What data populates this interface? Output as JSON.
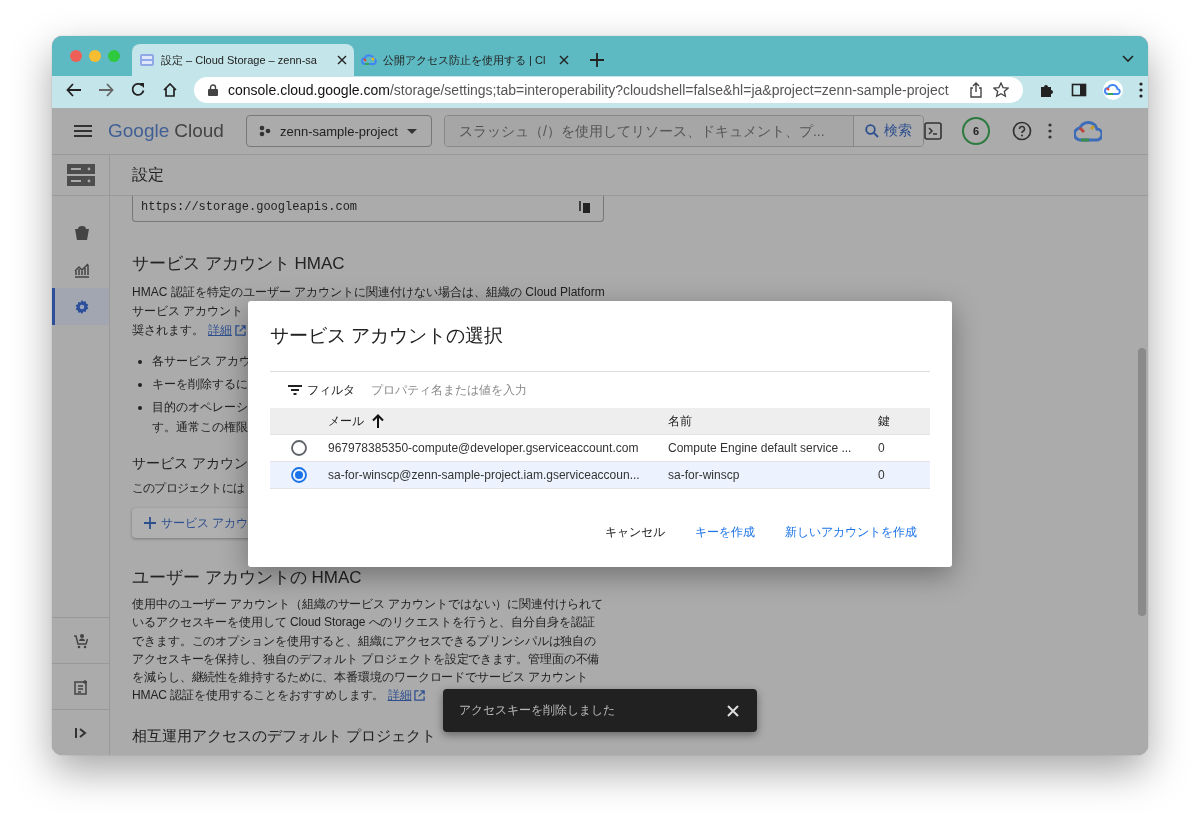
{
  "browser": {
    "tabs": [
      {
        "title": "設定 – Cloud Storage – zenn-sa",
        "selected": true
      },
      {
        "title": "公開アクセス防止を使用する | Cl",
        "selected": false
      }
    ],
    "url": {
      "host": "console.cloud.google.com",
      "path": "/storage/settings;tab=interoperability?cloudshell=false&hl=ja&project=zenn-sample-project"
    }
  },
  "header": {
    "logo": {
      "brand": "Google",
      "product": "Cloud"
    },
    "project": "zenn-sample-project",
    "search_placeholder": "スラッシュ（/）を使用してリソース、ドキュメント、プ...",
    "search_button": "検索",
    "badge": "6"
  },
  "sidebar": {
    "items": [
      {
        "kind": "bucket",
        "selected": false
      },
      {
        "kind": "chart",
        "selected": false
      },
      {
        "kind": "settings",
        "selected": true
      }
    ],
    "bottom_items": [
      {
        "kind": "cart"
      },
      {
        "kind": "notes"
      },
      {
        "kind": "expand"
      }
    ]
  },
  "page_title": "設定",
  "content": {
    "endpoint": "https://storage.googleapis.com",
    "sections": [
      {
        "heading": "サービス アカウント HMAC",
        "lines": [
          "HMAC 認証を特定のユーザー アカウントに関連付けない場合は、組織の Cloud Platform",
          "サービス アカウント"
        ],
        "last_line": "奨されます。",
        "link": "詳細",
        "bullets": [
          "各サービス アカウ",
          "キーを削除するに",
          "目的のオペレーシ"
        ],
        "bullet_tail": "す。通常この権限"
      },
      {
        "heading": "サービス アカウン",
        "lines": [
          "このプロジェクトには"
        ],
        "button": "サービス アカウ"
      },
      {
        "heading": "ユーザー アカウントの HMAC",
        "paragraph": "使用中のユーザー アカウント（組織のサービス アカウントではない）に関連付けられているアクセスキーを使用して Cloud Storage へのリクエストを行うと、自分自身を認証できます。このオプションを使用すると、組織にアクセスできるプリンシパルは独自のアクセスキーを保持し、独自のデフォルト プロジェクトを設定できます。管理面の不備を減らし、継続性を維持するために、本番環境のワークロードでサービス アカウント HMAC 認証を使用することをおすすめします。",
        "link": "詳細"
      },
      {
        "heading": "相互運用アクセスのデフォルト プロジェクト"
      }
    ]
  },
  "dialog": {
    "title": "サービス アカウントの選択",
    "filter_label": "フィルタ",
    "filter_placeholder": "プロパティ名または値を入力",
    "columns": [
      "メール",
      "名前",
      "鍵"
    ],
    "rows": [
      {
        "email": "967978385350-compute@developer.gserviceaccount.com",
        "name": "Compute Engine default service ...",
        "keys": "0",
        "selected": false
      },
      {
        "email": "sa-for-winscp@zenn-sample-project.iam.gserviceaccoun...",
        "name": "sa-for-winscp",
        "keys": "0",
        "selected": true
      }
    ],
    "buttons": [
      {
        "label": "キャンセル",
        "kind": "plain"
      },
      {
        "label": "キーを作成",
        "kind": "primary"
      },
      {
        "label": "新しいアカウントを作成",
        "kind": "primary"
      }
    ]
  },
  "snackbar": {
    "message": "アクセスキーを削除しました"
  }
}
